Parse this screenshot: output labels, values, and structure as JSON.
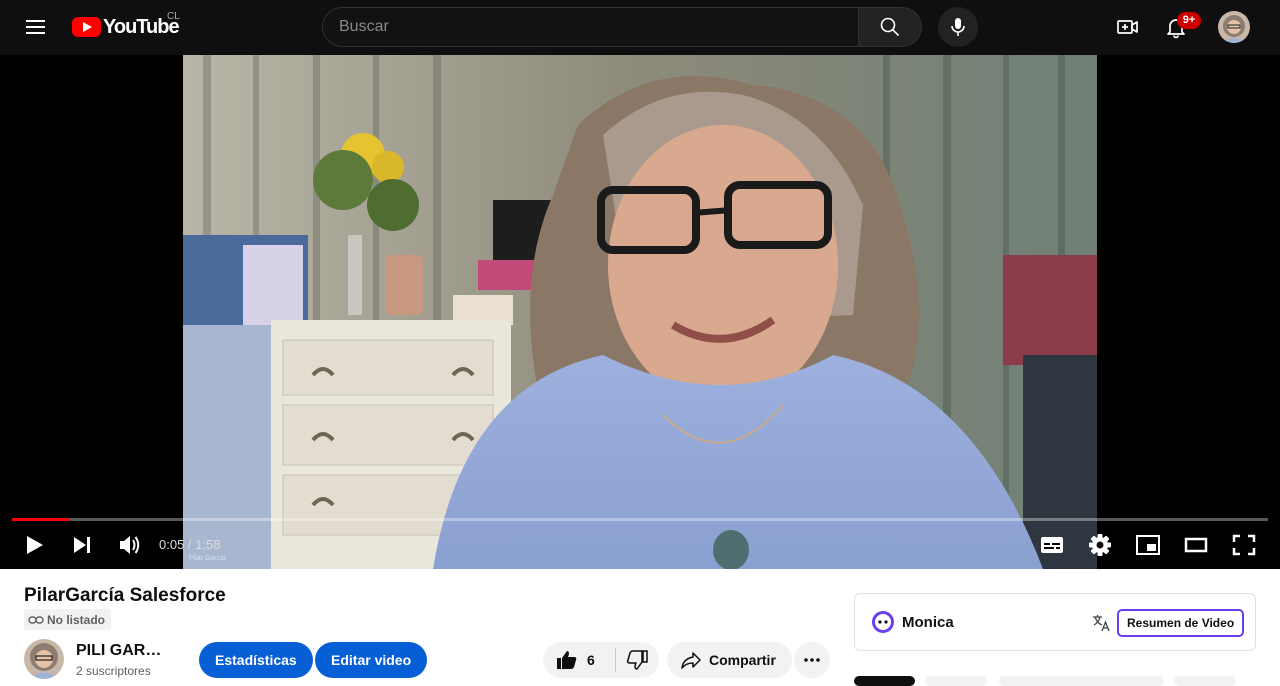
{
  "header": {
    "logo_text": "YouTube",
    "country_code": "CL",
    "search_placeholder": "Buscar",
    "notification_badge": "9+"
  },
  "player": {
    "current_time": "0:05",
    "duration": "1:58",
    "time_display": "0:05 / 1:58",
    "progress_fraction": 0.046,
    "watermark": "Pilar García",
    "accent_color": "#ff0000"
  },
  "video": {
    "title": "PilarGarcía Salesforce",
    "visibility": "No listado",
    "channel_name": "PILI GARCIA",
    "subscribers": "2 suscriptores",
    "stats_label": "Estadísticas",
    "edit_label": "Editar video",
    "like_count": "6",
    "share_label": "Compartir"
  },
  "monica": {
    "name": "Monica",
    "summary_label": "Resumen de Video",
    "accent_color": "#6b3ff0"
  },
  "icons": {
    "menu": "hamburger-icon",
    "search": "search-icon",
    "mic": "microphone-icon",
    "create": "create-video-icon",
    "notifications": "bell-icon",
    "play": "play-icon",
    "next": "next-icon",
    "volume": "volume-icon",
    "subtitles": "subtitles-icon",
    "settings": "gear-icon",
    "miniplayer": "miniplayer-icon",
    "theater": "theater-mode-icon",
    "fullscreen": "fullscreen-icon"
  }
}
